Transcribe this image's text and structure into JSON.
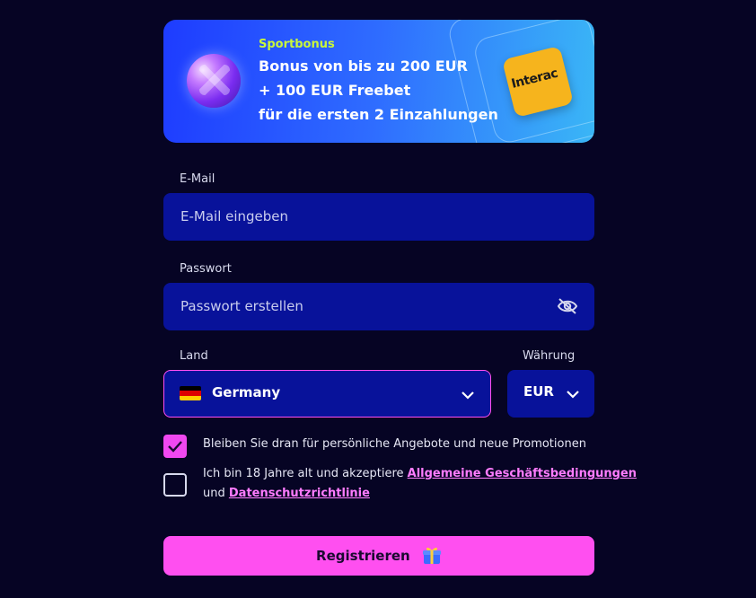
{
  "banner": {
    "kicker": "Sportbonus",
    "line1": "Bonus von bis zu 200 EUR",
    "line2": "+ 100 EUR Freebet",
    "line3": "für die ersten 2 Einzahlungen",
    "logo_text": "Interac",
    "icons": [
      "soccer-ball-icon",
      "interac-logo"
    ]
  },
  "email": {
    "label": "E-Mail",
    "placeholder": "E-Mail eingeben"
  },
  "password": {
    "label": "Passwort",
    "placeholder": "Passwort erstellen",
    "toggle_icon": "eye-off-icon"
  },
  "country": {
    "label": "Land",
    "value": "Germany",
    "flag_icon": "germany-flag-icon"
  },
  "currency": {
    "label": "Währung",
    "value": "EUR"
  },
  "consent": {
    "promo_text": "Bleiben Sie dran für persönliche Angebote und neue Promotionen",
    "promo_checked": true,
    "terms_prefix": "Ich bin 18 Jahre alt und akzeptiere",
    "terms_link": "Allgemeine Geschäftsbedingungen",
    "terms_and": "und",
    "privacy_link": "Datenschutzrichtlinie",
    "terms_checked": false
  },
  "submit": {
    "label": "Registrieren",
    "icon": "gift-icon"
  },
  "colors": {
    "background": "#060424",
    "field": "#08129a",
    "accent": "#ff4ff0",
    "banner_kicker": "#c9f73a"
  }
}
